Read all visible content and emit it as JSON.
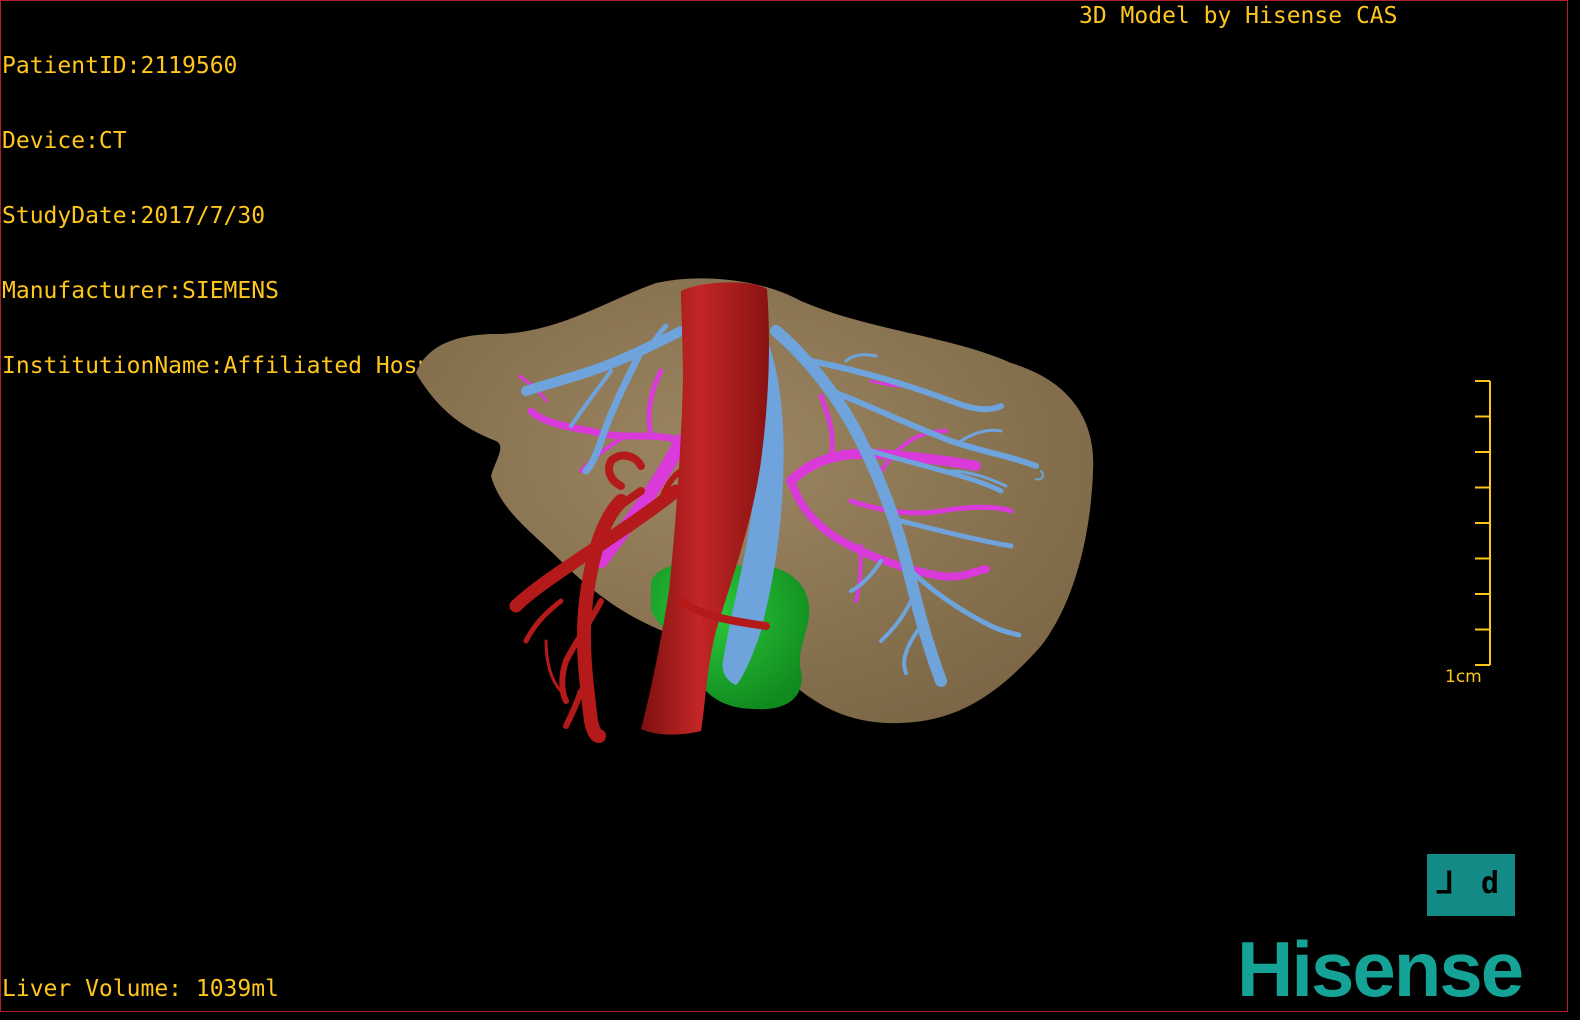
{
  "patient_info": {
    "patient_id": "PatientID:2119560",
    "device": "Device:CT",
    "study_date": "StudyDate:2017/7/30",
    "manufacturer": "Manufacturer:SIEMENS",
    "institution": "InstitutionName:Affiliated Hospital Qingdao University-C"
  },
  "credit": "3D Model by Hisense CAS",
  "liver_volume": "Liver Volume: 1039ml",
  "scale_bar": {
    "label": "1cm",
    "tick_count": 9
  },
  "orientation_cube": {
    "left_face": "⅃",
    "right_face": "d"
  },
  "brand": "Hisense",
  "colors": {
    "overlay_text": "#ffc61e",
    "liver": "#8b7553",
    "hepatic_artery": "#b51a1a",
    "portal_vein": "#d93ad9",
    "hepatic_vein": "#6fa3dc",
    "gallbladder": "#16a52a",
    "brand": "#14a396",
    "frame": "#b0202a"
  },
  "icons": [
    "orientation-cube-icon",
    "hisense-logo-icon"
  ]
}
